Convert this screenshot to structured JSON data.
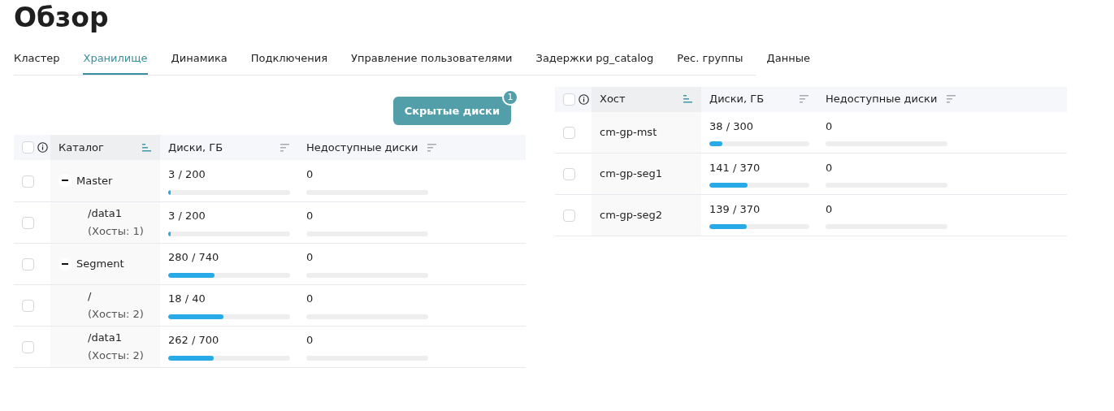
{
  "title": "Обзор",
  "tabs": [
    {
      "label": "Кластер",
      "selected": false
    },
    {
      "label": "Хранилище",
      "selected": true
    },
    {
      "label": "Динамика",
      "selected": false
    },
    {
      "label": "Подключения",
      "selected": false
    },
    {
      "label": "Управление пользователями",
      "selected": false
    },
    {
      "label": "Задержки pg_catalog",
      "selected": false
    },
    {
      "label": "Рес. группы",
      "selected": false
    },
    {
      "label": "Данные",
      "selected": false
    }
  ],
  "hidden_disks_button": {
    "label": "Скрытые диски",
    "badge": "1"
  },
  "catalog_table": {
    "select_all_checked": false,
    "columns": [
      {
        "label": "Каталог",
        "sorted": true
      },
      {
        "label": "Диски, ГБ",
        "sorted": false
      },
      {
        "label": "Недоступные диски",
        "sorted": false
      }
    ],
    "rows": [
      {
        "name": "Master",
        "expanded": true,
        "checked": false,
        "disks": {
          "text": "3 / 200",
          "level": 0.015
        },
        "unavailable": {
          "text": "0",
          "level": 0
        },
        "children": [
          {
            "name": "/data1",
            "hosts": "(Хосты: 1)",
            "checked": false,
            "disks": {
              "text": "3 / 200",
              "level": 0.015
            },
            "unavailable": {
              "text": "0",
              "level": 0
            }
          }
        ]
      },
      {
        "name": "Segment",
        "expanded": true,
        "checked": false,
        "disks": {
          "text": "280 / 740",
          "level": 0.38
        },
        "unavailable": {
          "text": "0",
          "level": 0
        },
        "children": [
          {
            "name": "/",
            "hosts": "(Хосты: 2)",
            "checked": false,
            "disks": {
              "text": "18 / 40",
              "level": 0.45
            },
            "unavailable": {
              "text": "0",
              "level": 0
            }
          },
          {
            "name": "/data1",
            "hosts": "(Хосты: 2)",
            "checked": false,
            "disks": {
              "text": "262 / 700",
              "level": 0.37
            },
            "unavailable": {
              "text": "0",
              "level": 0
            }
          }
        ]
      }
    ]
  },
  "host_table": {
    "select_all_checked": false,
    "columns": [
      {
        "label": "Хост",
        "sorted": true
      },
      {
        "label": "Диски, ГБ",
        "sorted": false
      },
      {
        "label": "Недоступные диски",
        "sorted": false
      }
    ],
    "rows": [
      {
        "name": "cm-gp-mst",
        "checked": false,
        "disks": {
          "text": "38 / 300",
          "level": 0.127
        },
        "unavailable": {
          "text": "0",
          "level": 0
        }
      },
      {
        "name": "cm-gp-seg1",
        "checked": false,
        "disks": {
          "text": "141 / 370",
          "level": 0.38
        },
        "unavailable": {
          "text": "0",
          "level": 0
        }
      },
      {
        "name": "cm-gp-seg2",
        "checked": false,
        "disks": {
          "text": "139 / 370",
          "level": 0.376
        },
        "unavailable": {
          "text": "0",
          "level": 0
        }
      }
    ]
  }
}
